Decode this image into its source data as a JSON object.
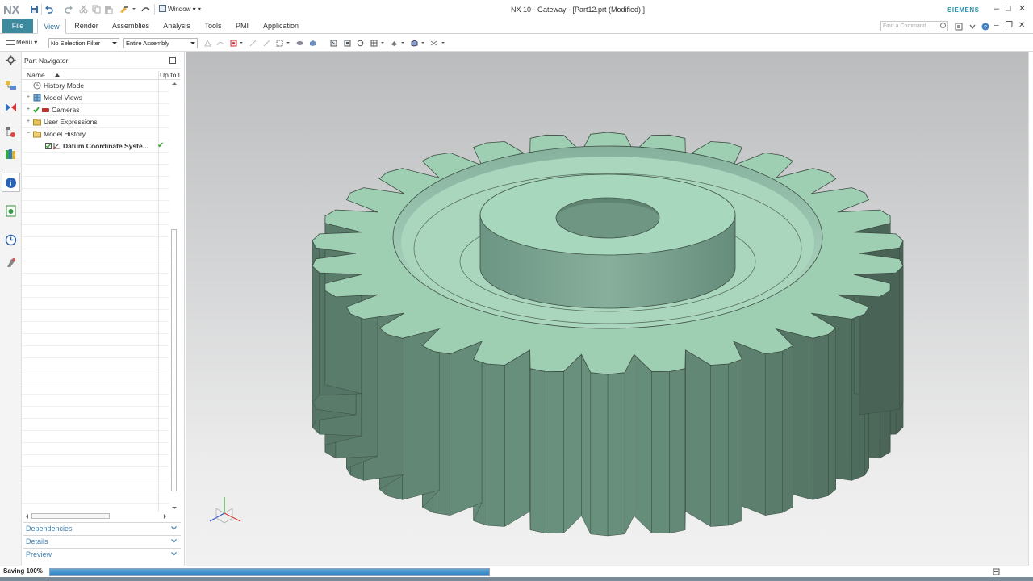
{
  "app": {
    "logo": "NX",
    "window_menu": "Window",
    "title": "NX 10 - Gateway - [Part12.prt (Modified) ]",
    "brand": "SIEMENS",
    "brand_color": "#2b8fa8"
  },
  "window_controls": {
    "minimize": "–",
    "maximize": "□",
    "close": "✕",
    "restore": "❐"
  },
  "ribbon": {
    "file_tab": "File",
    "tabs": [
      "View",
      "Render",
      "Assemblies",
      "Analysis",
      "Tools",
      "PMI",
      "Application"
    ],
    "active_tab": "View",
    "find_placeholder": "Find a Command",
    "accent_color": "#3d8a9e"
  },
  "toolbar": {
    "menu_label": "Menu",
    "selection_filter": "No Selection Filter",
    "assembly_scope": "Entire Assembly"
  },
  "resource_bar": {
    "icons": [
      "settings-icon",
      "assembly-navigator-icon",
      "constraint-navigator-icon",
      "part-navigator-icon",
      "reuse-library-icon",
      "hd3d-tools-icon",
      "web-browser-icon",
      "history-icon",
      "system-materials-icon"
    ]
  },
  "navigator": {
    "title": "Part Navigator",
    "columns": {
      "name": "Name",
      "up_to": "Up to I"
    },
    "rows": [
      {
        "label": "History Mode",
        "icon": "history-mode-icon",
        "bold": false,
        "checked": false,
        "ok": false
      },
      {
        "label": "Model Views",
        "icon": "model-views-icon",
        "bold": false,
        "checked": false,
        "ok": false
      },
      {
        "label": "Cameras",
        "icon": "cameras-icon",
        "bold": false,
        "checked": true,
        "ok": false
      },
      {
        "label": "User Expressions",
        "icon": "folder-icon",
        "bold": false,
        "checked": false,
        "ok": false
      },
      {
        "label": "Model History",
        "icon": "folder-icon",
        "bold": false,
        "checked": false,
        "ok": false
      },
      {
        "label": "Datum Coordinate Syste...",
        "icon": "datum-csys-icon",
        "bold": true,
        "checked": true,
        "ok": true
      }
    ],
    "panels": [
      "Dependencies",
      "Details",
      "Preview"
    ]
  },
  "status": {
    "text": "Saving 100%",
    "progress": 1.0,
    "progress_color": "#2d7fc2"
  },
  "graphics": {
    "model": "spur-gear",
    "model_color": "#9fcfb3",
    "background_top": "#bbbcbd",
    "background_bottom": "#f1f1f1",
    "tooth_count": 30
  }
}
